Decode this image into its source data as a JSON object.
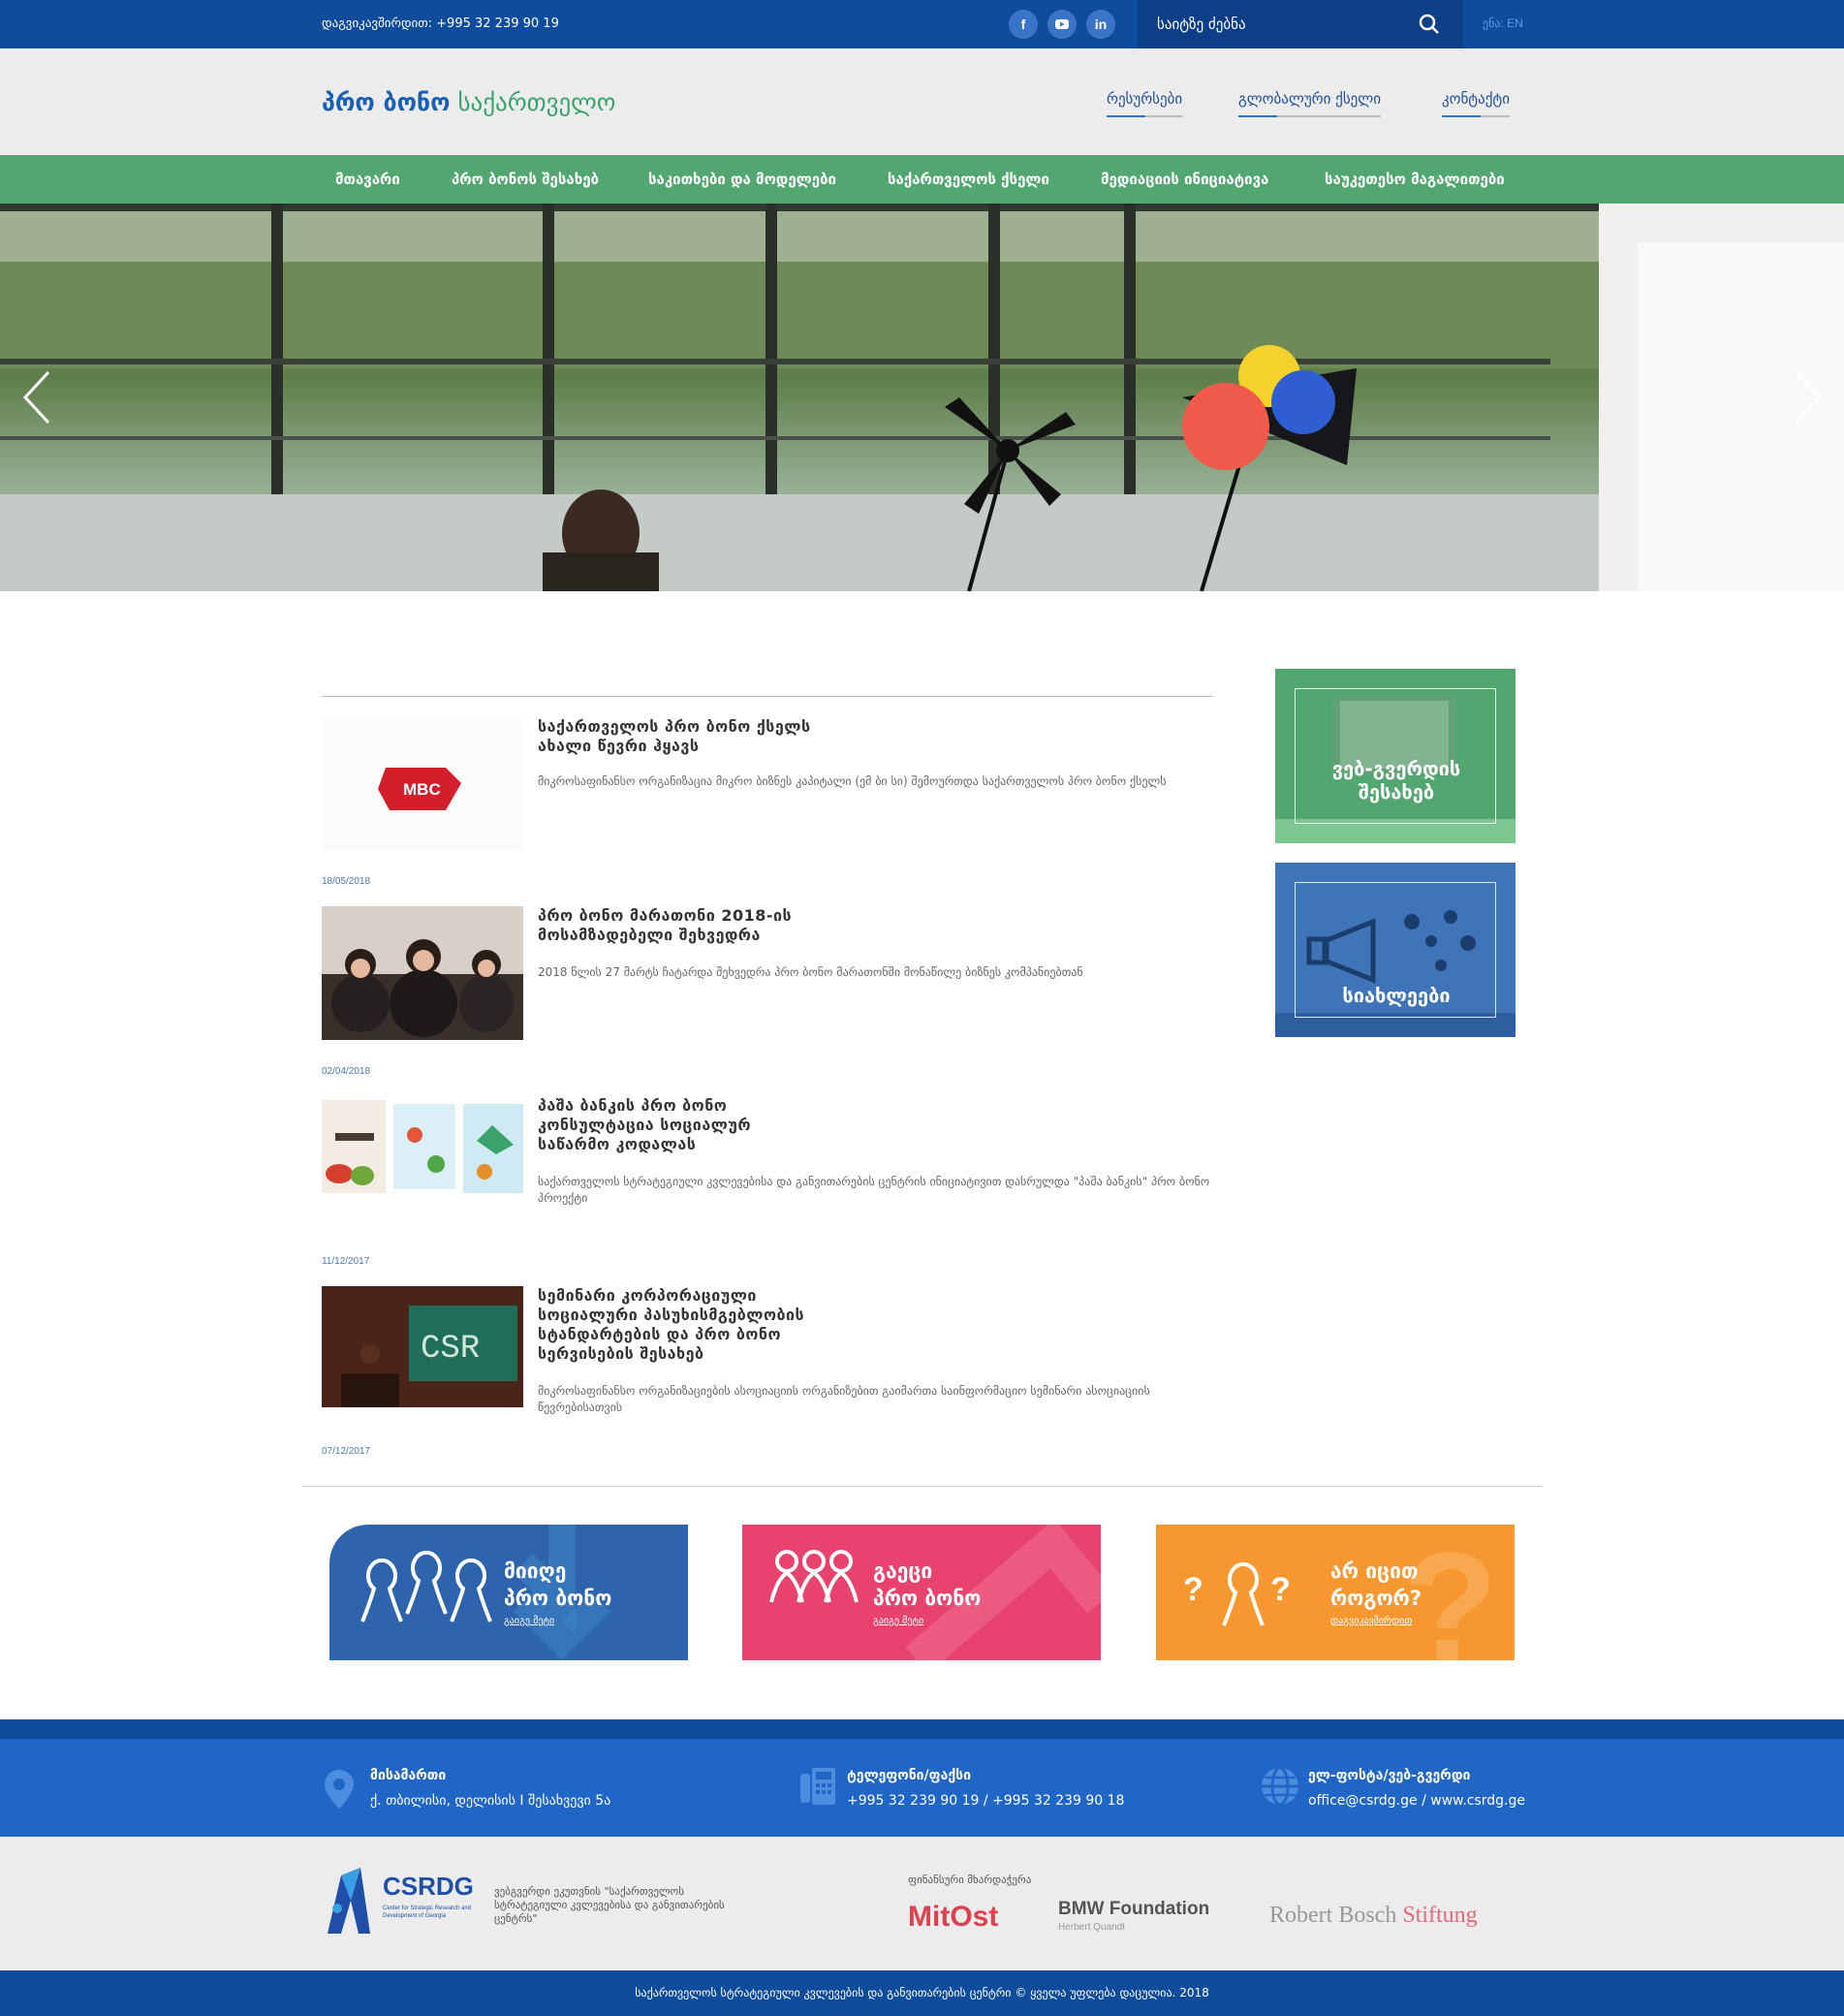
{
  "topbar": {
    "phone": "დაგვიკავშირდით: +995 32 239 90 19",
    "social": {
      "facebook": "f",
      "youtube": "▶",
      "linkedin": "in"
    },
    "search_placeholder": "საიტზე ძებნა",
    "lang": "ენა: EN"
  },
  "header": {
    "logo_part1": "პრო ბონო",
    "logo_part2": "საქართველო",
    "links": [
      "რესურსები",
      "გლობალური ქსელი",
      "კონტაქტი"
    ]
  },
  "nav": [
    "მთავარი",
    "პრო ბონოს შესახებ",
    "საკითხები და მოდელები",
    "საქართველოს ქსელი",
    "მედიაციის ინიციატივა",
    "საუკეთესო მაგალითები"
  ],
  "news": [
    {
      "title": "საქართველოს პრო ბონო ქსელს ახალი წევრი ჰყავს",
      "description": "მიკროსაფინანსო ორგანიზაცია მიკრო ბიზნეს კაპიტალი (ემ ბი სი) შემოურთდა საქართველოს პრო ბონო ქსელს",
      "date": "18/05/2018",
      "thumb_text": "MBC"
    },
    {
      "title": "პრო ბონო მარათონი 2018-ის მოსამზადებელი შეხვედრა",
      "description": "2018 წლის 27 მარტს ჩატარდა შეხვედრა პრო ბონო მარათონში მონაწილე ბიზნეს კომპანიებთან",
      "date": "02/04/2018"
    },
    {
      "title": "პაშა ბანკის პრო ბონო კონსულტაცია სოციალურ საწარმო კოდალას",
      "description": "საქართველოს სტრატეგიული კვლევებისა და განვითარების ცენტრის ინიციატივით დასრულდა \"პაშა ბანკის\" პრო ბონო პროექტი",
      "date": "11/12/2017"
    },
    {
      "title": "სემინარი კორპორაციული სოციალური პასუხისმგებლობის სტანდარტების და პრო ბონო სერვისების შესახებ",
      "description": "მიკროსაფინანსო ორგანიზაციების ასოციაციის ორგანიზებით გაიმართა საინფორმაციო სემინარი ასოციაციის წევრებისათვის",
      "date": "07/12/2017",
      "thumb_text": "CSR"
    }
  ],
  "sidebar": [
    {
      "label": "ვებ-გვერდის შესახებ",
      "color": "#52a66f"
    },
    {
      "label": "სიახლეები",
      "color": "#3f75b8"
    }
  ],
  "cta": [
    {
      "line1": "მიიღე",
      "line2": "პრო ბონო",
      "link": "გაიგე მეტი",
      "color": "#2d64ad"
    },
    {
      "line1": "გაეცი",
      "line2": "პრო ბონო",
      "link": "გაიგე მეტი",
      "color": "#e8436e"
    },
    {
      "line1": "არ იცით",
      "line2": "როგორ?",
      "link": "დაგვიკავშირდით",
      "color": "#f7972f"
    }
  ],
  "footer": {
    "address_label": "მისამართი",
    "address": "ქ. თბილისი, დელისის I შესახვევი 5ა",
    "phone_label": "ტელეფონი/ფაქსი",
    "phone": "+995 32 239 90 19 / +995 32 239 90 18",
    "email_label": "ელ-ფოსტა/ვებ-გვერდი",
    "email": "office@csrdg.ge / www.csrdg.ge"
  },
  "partners": {
    "csrdg_logo": "CSRDG",
    "csrdg_sub": "Center for Strategic Research and Development of Georgia",
    "csrdg_text": "ვებგვერდი ეკუთვნის \"საქართველოს სტრატეგიული კვლევებისა და განვითარების ცენტრს\"",
    "financial_label": "ფინანსური მხარდაჭერა",
    "mitost": "MitOst",
    "bmw": "BMW Foundation",
    "bmw_sub": "Herbert Quandt",
    "bosch1": "Robert Bosch",
    "bosch2": "Stiftung"
  },
  "copyright": "საქართველოს სტრატეგიული კვლევების და განვითარების ცენტრი © ყველა უფლება დაცულია. 2018"
}
